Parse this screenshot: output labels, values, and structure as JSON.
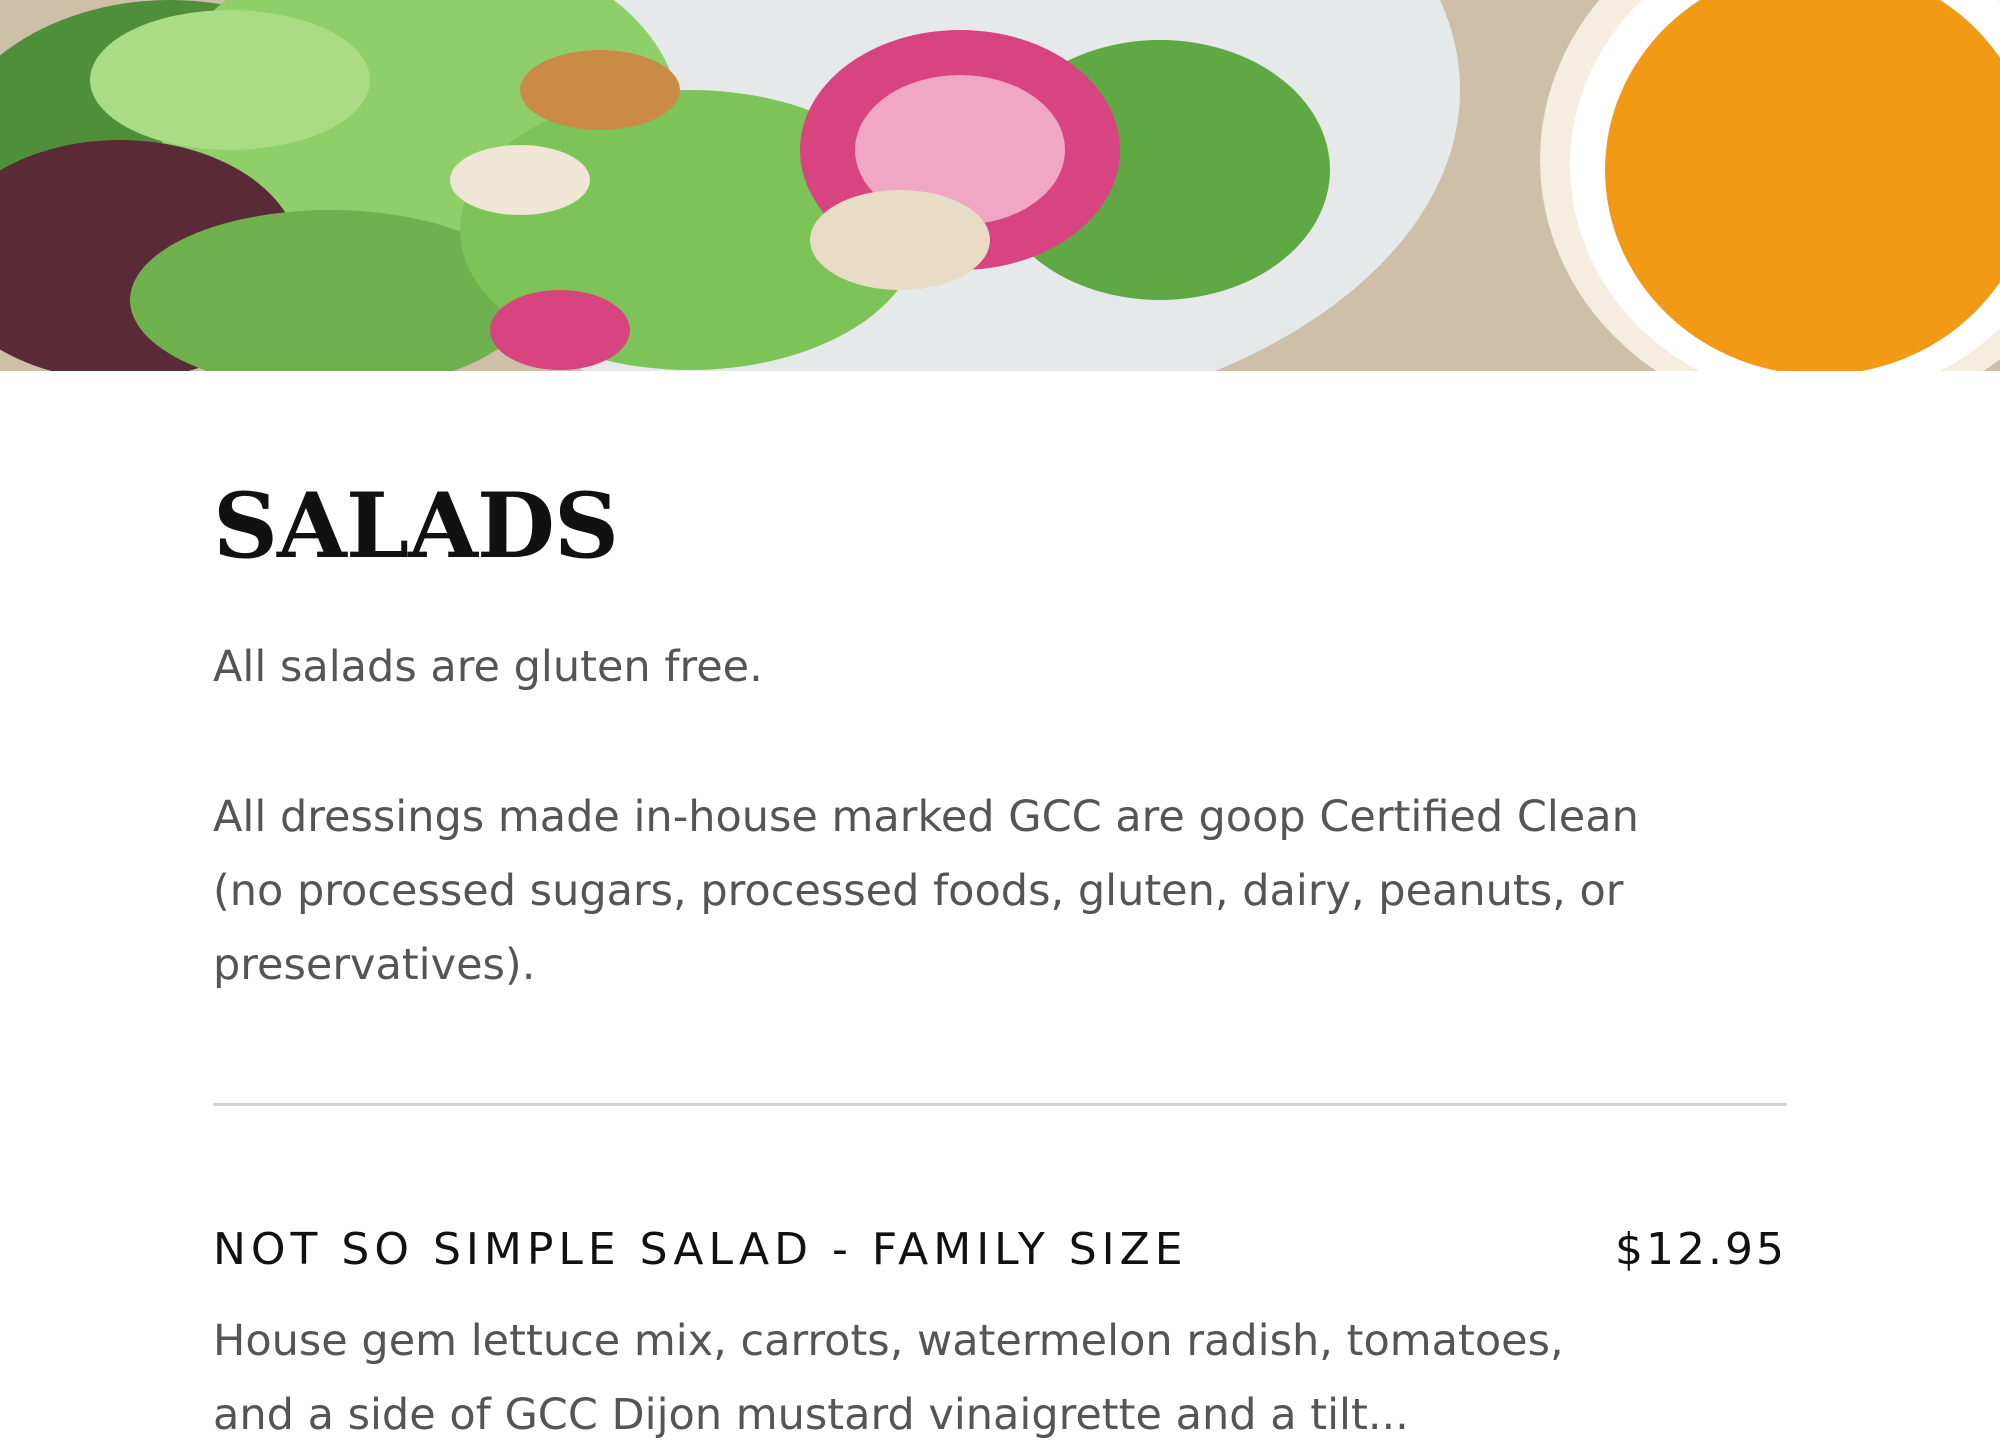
{
  "hero": {
    "image_name": "salad-and-dressing-photo",
    "colors": {
      "background": "#cdbfa8",
      "plate": "#e6e9ea",
      "lettuce_light": "#8fcf6a",
      "lettuce_dark": "#4f8f3a",
      "radicchio": "#5a2a36",
      "radish_pink": "#d8447f",
      "dressing": "#f29a16",
      "bowl": "#f4ede0"
    }
  },
  "section": {
    "title": "SALADS",
    "note_1": "All salads are gluten free.",
    "note_2": "All dressings made in-house marked GCC are goop Certified Clean (no processed sugars, processed foods, gluten, dairy, peanuts, or preservatives)."
  },
  "items": [
    {
      "name": "NOT SO SIMPLE SALAD - FAMILY SIZE",
      "price": "$12.95",
      "description": "House gem lettuce mix, carrots, watermelon radish, tomatoes, and a side of GCC Dijon mustard vinaigrette and a tilt..."
    }
  ]
}
